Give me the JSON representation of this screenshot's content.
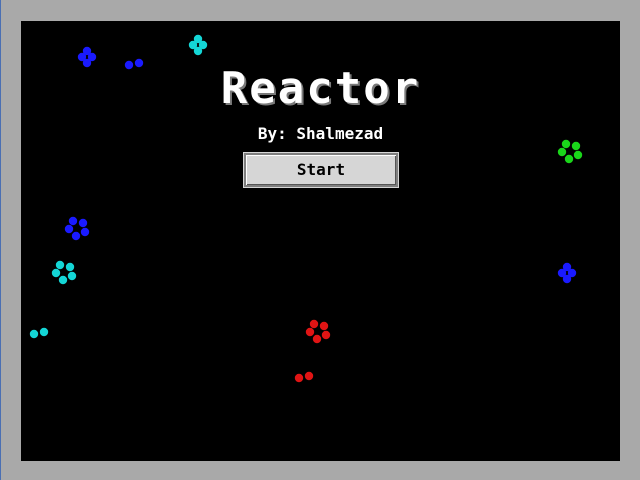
{
  "game": {
    "title": "Reactor",
    "byline": "By: Shalmezad",
    "start_label": "Start"
  },
  "colors": {
    "background": "#000000",
    "frame": "#a9a9a9",
    "blue": "#1a1aff",
    "cyan": "#14d6d6",
    "green": "#1ad61a",
    "red": "#e01414"
  },
  "particles": [
    {
      "name": "blue-particle-cluster",
      "color": "blue",
      "atoms": 4
    },
    {
      "name": "blue-particle-cluster",
      "color": "blue",
      "atoms": 2
    },
    {
      "name": "cyan-particle-cluster",
      "color": "cyan",
      "atoms": 4
    },
    {
      "name": "green-particle-cluster",
      "color": "green",
      "atoms": 5
    },
    {
      "name": "blue-particle-cluster",
      "color": "blue",
      "atoms": 5
    },
    {
      "name": "cyan-particle-cluster",
      "color": "cyan",
      "atoms": 5
    },
    {
      "name": "blue-particle-cluster",
      "color": "blue",
      "atoms": 4
    },
    {
      "name": "cyan-particle-cluster",
      "color": "cyan",
      "atoms": 2
    },
    {
      "name": "red-particle-cluster",
      "color": "red",
      "atoms": 5
    },
    {
      "name": "red-particle-cluster",
      "color": "red",
      "atoms": 2
    }
  ]
}
